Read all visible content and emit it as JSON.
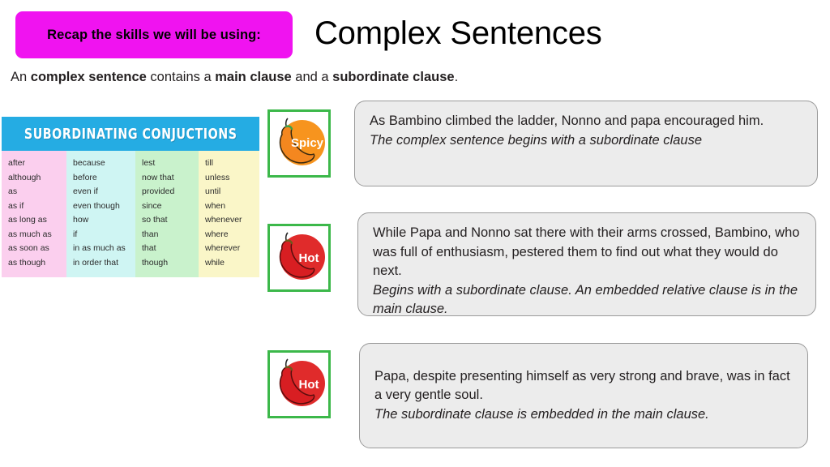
{
  "header": {
    "recap_label": "Recap the skills we will be using:",
    "title": "Complex Sentences",
    "definition_prefix": "An ",
    "definition_bold_1": "complex sentence",
    "definition_middle_1": " contains a ",
    "definition_bold_2": "main clause",
    "definition_middle_2": " and a ",
    "definition_bold_3": "subordinate clause",
    "definition_suffix": "."
  },
  "colors": {
    "recap_banner": "#F013F0",
    "table_header": "#25ACE3",
    "col_1": "#FBCFEE",
    "col_2": "#CFF5F3",
    "col_3": "#C9F2CC",
    "col_4": "#FAF6C8",
    "icon_border": "#3CB84A",
    "spicy_circle": "#F7941E",
    "hot_circle": "#E02B2B",
    "example_box_fill": "#ECECEC"
  },
  "conjunctions_table": {
    "title": "SUBORDINATING CONJUCTIONS",
    "columns": [
      {
        "items": [
          "after",
          "although",
          "as",
          "as if",
          "as long as",
          "as much as",
          "as soon as",
          "as though"
        ]
      },
      {
        "items": [
          "because",
          "before",
          "even if",
          "even though",
          "how",
          "if",
          "in as much as",
          "in order that"
        ]
      },
      {
        "items": [
          "lest",
          "now that",
          "provided",
          "since",
          "so that",
          "than",
          "that",
          "though"
        ]
      },
      {
        "items": [
          "till",
          "unless",
          "until",
          "when",
          "whenever",
          "where",
          "wherever",
          "while"
        ]
      }
    ]
  },
  "spice_icons": [
    {
      "label": "Spicy",
      "level": "spicy"
    },
    {
      "label": "Hot",
      "level": "hot"
    },
    {
      "label": "Hot",
      "level": "hot"
    }
  ],
  "examples": [
    {
      "sentence": "As Bambino climbed the ladder, Nonno and papa encouraged him.",
      "note": "The complex sentence begins with a subordinate clause"
    },
    {
      "sentence": "While Papa and Nonno sat there with their arms crossed, Bambino, who was full of enthusiasm, pestered them to find out what they would do next.",
      "note": "Begins with a subordinate clause. An embedded relative clause is in the main clause."
    },
    {
      "sentence": "Papa, despite presenting himself as very strong and brave, was in fact a very gentle soul.",
      "note": "The subordinate clause is embedded in the main clause."
    }
  ]
}
